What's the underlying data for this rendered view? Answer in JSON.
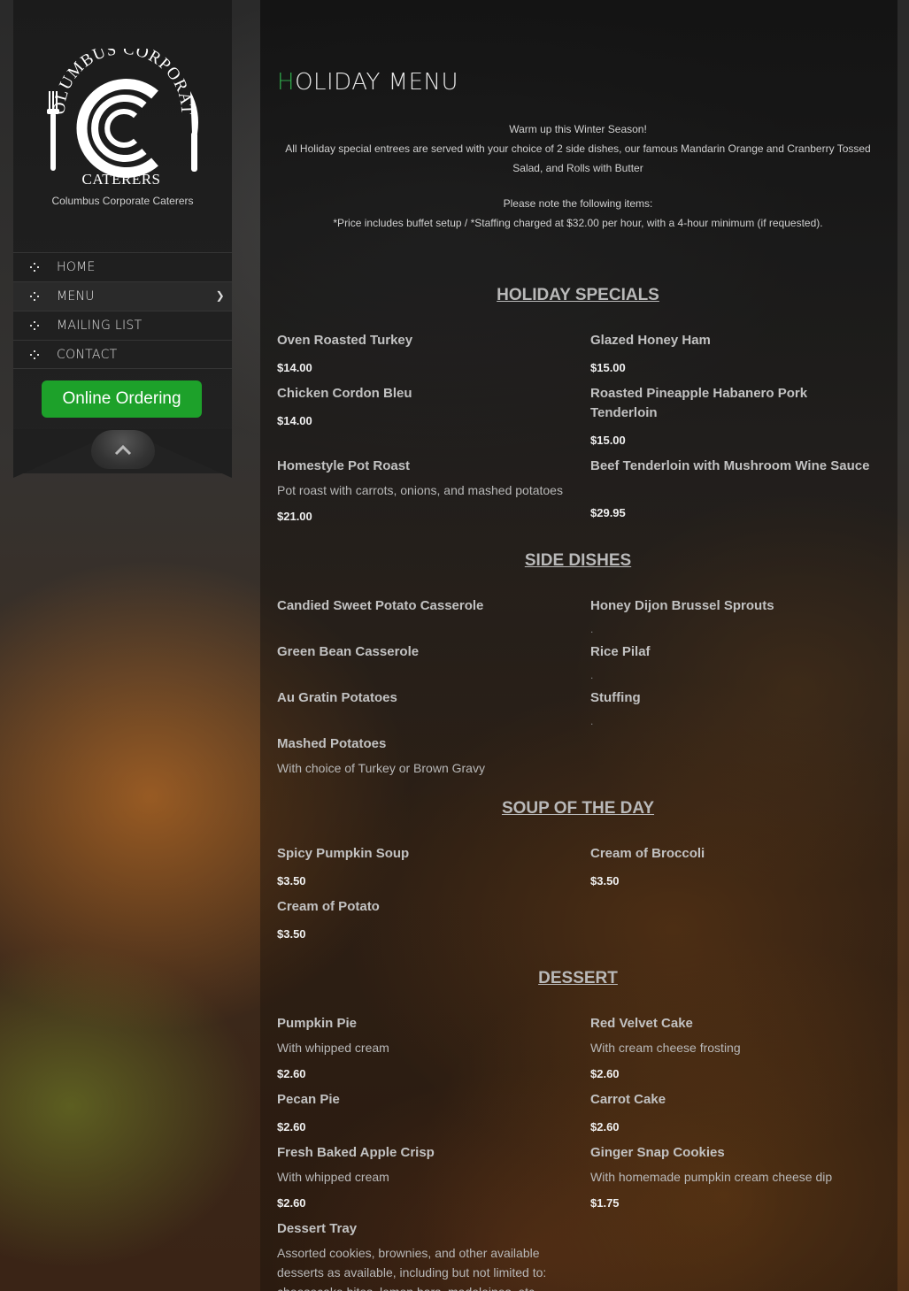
{
  "brand": {
    "name": "Columbus Corporate Caterers",
    "logo_arc_text": "COLUMBUS CORPORATE",
    "logo_bottom_text": "CATERERS"
  },
  "nav": {
    "items": [
      {
        "label": "HOME"
      },
      {
        "label": "MENU",
        "has_submenu": true
      },
      {
        "label": "MAILING LIST"
      },
      {
        "label": "CONTACT"
      }
    ],
    "order_button": "Online Ordering"
  },
  "page": {
    "title_first": "H",
    "title_rest": "OLIDAY MENU",
    "intro_line1": "Warm up this Winter Season!",
    "intro_line2": "All Holiday special entrees are served with your choice of 2 side dishes, our famous Mandarin Orange and Cranberry Tossed",
    "intro_line3": "Salad, and Rolls with Butter",
    "note_line1": "Please note the following items:",
    "note_line2": "*Price includes buffet setup / *Staffing charged at $32.00 per hour, with a 4-hour minimum (if requested)."
  },
  "sections": {
    "specials": {
      "title": "HOLIDAY SPECIALS",
      "items": [
        {
          "name": "Oven Roasted Turkey",
          "price": "$14.00"
        },
        {
          "name": "Glazed Honey Ham",
          "price": "$15.00"
        },
        {
          "name": "Chicken Cordon Bleu",
          "price": "$14.00"
        },
        {
          "name": "Roasted Pineapple Habanero Pork Tenderloin",
          "price": "$15.00"
        },
        {
          "name": "Homestyle Pot Roast",
          "desc": "Pot roast with carrots, onions, and mashed potatoes",
          "price": "$21.00"
        },
        {
          "name": "Beef Tenderloin with Mushroom Wine Sauce",
          "price": "$29.95"
        }
      ]
    },
    "sides": {
      "title": "SIDE DISHES",
      "items": [
        {
          "name": "Candied Sweet Potato Casserole"
        },
        {
          "name": "Honey Dijon Brussel Sprouts",
          "desc": "."
        },
        {
          "name": "Green Bean Casserole"
        },
        {
          "name": "Rice Pilaf",
          "desc": "."
        },
        {
          "name": "Au Gratin Potatoes"
        },
        {
          "name": "Stuffing",
          "desc": "."
        },
        {
          "name": "Mashed Potatoes",
          "desc": "With choice of Turkey or Brown Gravy"
        }
      ]
    },
    "soup": {
      "title": "SOUP OF THE DAY",
      "items": [
        {
          "name": "Spicy Pumpkin Soup",
          "price": "$3.50"
        },
        {
          "name": "Cream of Broccoli",
          "price": "$3.50"
        },
        {
          "name": "Cream of Potato",
          "price": "$3.50"
        }
      ]
    },
    "dessert": {
      "title": "DESSERT",
      "items": [
        {
          "name": "Pumpkin Pie",
          "desc": "With whipped cream",
          "price": "$2.60"
        },
        {
          "name": "Red Velvet Cake",
          "desc": "With cream cheese frosting",
          "price": "$2.60"
        },
        {
          "name": "Pecan Pie",
          "price": "$2.60"
        },
        {
          "name": "Carrot Cake",
          "price": "$2.60"
        },
        {
          "name": "Fresh Baked Apple Crisp",
          "desc": "With whipped cream",
          "price": "$2.60"
        },
        {
          "name": "Ginger Snap Cookies",
          "desc": "With homemade pumpkin cream cheese dip",
          "price": "$1.75"
        },
        {
          "name": "Dessert Tray",
          "desc_line1": "Assorted cookies, brownies, and other available",
          "desc_line2": "desserts as available, including but not limited to:",
          "desc_line3": "cheesecake bites, lemon bars, madeleines, etc."
        }
      ]
    }
  },
  "colors": {
    "accent": "#2fa84a",
    "order_button": "#1da12a"
  }
}
